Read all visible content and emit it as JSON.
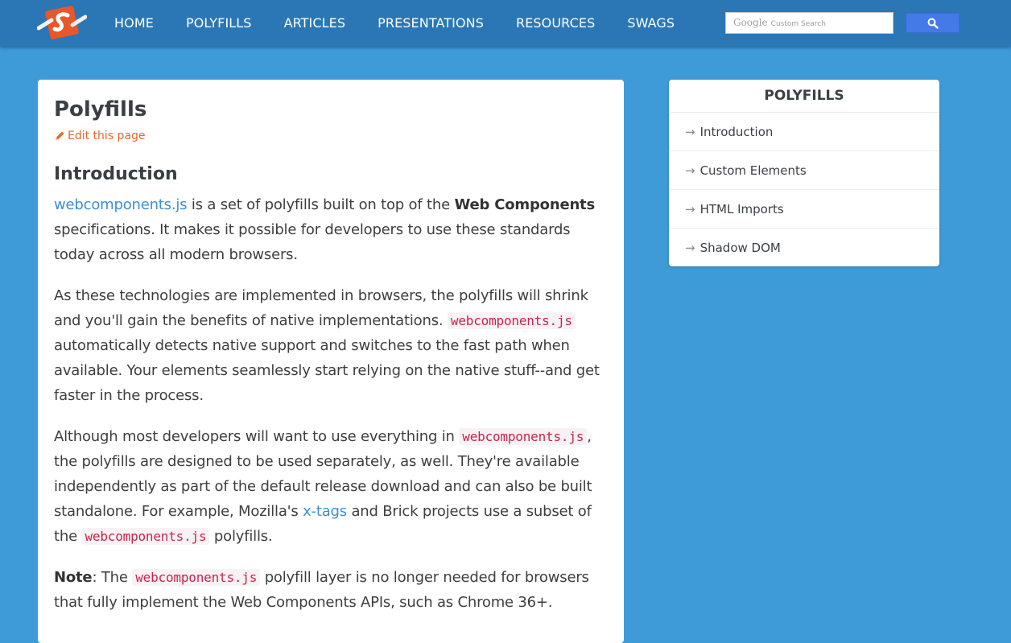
{
  "nav": {
    "logo": "site-logo",
    "items": [
      {
        "label": "HOME"
      },
      {
        "label": "POLYFILLS"
      },
      {
        "label": "ARTICLES"
      },
      {
        "label": "PRESENTATIONS"
      },
      {
        "label": "RESOURCES"
      },
      {
        "label": "SWAGS"
      }
    ],
    "search": {
      "brand": "Google",
      "placeholder": "Custom Search",
      "button_icon": "search-icon"
    }
  },
  "main": {
    "title": "Polyfills",
    "edit_link": "Edit this page",
    "section_title": "Introduction",
    "p1": {
      "link": "webcomponents.js",
      "text1": " is a set of polyfills built on top of the ",
      "bold": "Web Components",
      "text2": " specifications. It makes it possible for developers to use these standards today across all modern browsers."
    },
    "p2": {
      "text1": "As these technologies are implemented in browsers, the polyfills will shrink and you'll gain the benefits of native implementations. ",
      "code": "webcomponents.js",
      "text2": " automatically detects native support and switches to the fast path when available. Your elements seamlessly start relying on the native stuff--and get faster in the process."
    },
    "p3": {
      "text1": "Although most developers will want to use everything in ",
      "code1": "webcomponents.js",
      "text2": ", the polyfills are designed to be used separately, as well. They're available independently as part of the default release download and can also be built standalone. For example, Mozilla's ",
      "link": "x-tags",
      "text3": " and Brick projects use a subset of the ",
      "code2": "webcomponents.js",
      "text4": " polyfills."
    },
    "p4": {
      "bold": "Note",
      "text1": ": The ",
      "code": "webcomponents.js",
      "text2": " polyfill layer is no longer needed for browsers that fully implement the Web Components APIs, such as Chrome 36+."
    }
  },
  "sidebar": {
    "title": "POLYFILLS",
    "items": [
      {
        "label": "Introduction"
      },
      {
        "label": "Custom Elements"
      },
      {
        "label": "HTML Imports"
      },
      {
        "label": "Shadow DOM"
      }
    ]
  },
  "colors": {
    "background": "#3e9bd8",
    "topbar": "#2b77b5",
    "accent_orange": "#e8662b",
    "link": "#3d8fd2",
    "code": "#c7254e",
    "search_button": "#4479e8"
  }
}
